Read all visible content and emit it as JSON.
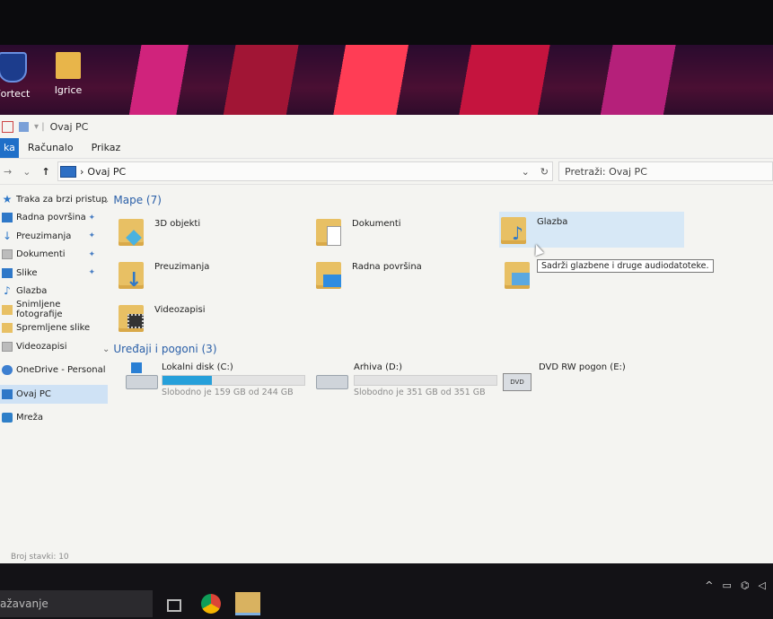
{
  "desktop": {
    "icons": [
      {
        "label": "Fortect",
        "icon": "shield-icon"
      },
      {
        "label": "Igrice",
        "icon": "folder-icon"
      }
    ]
  },
  "window": {
    "title": "Ovaj PC",
    "ribbon_tabs": [
      "ka",
      "Računalo",
      "Prikaz"
    ],
    "address": "Ovaj PC",
    "search_placeholder": "Pretraži: Ovaj PC",
    "status": "Broj stavki: 10"
  },
  "sidebar": {
    "items": [
      {
        "label": "Traka za brzi pristup",
        "icon": "star-icon",
        "pinned": false
      },
      {
        "label": "Radna površina",
        "icon": "desktop-icon",
        "pinned": true
      },
      {
        "label": "Preuzimanja",
        "icon": "download-icon",
        "pinned": true
      },
      {
        "label": "Dokumenti",
        "icon": "document-icon",
        "pinned": true
      },
      {
        "label": "Slike",
        "icon": "pictures-icon",
        "pinned": true
      },
      {
        "label": "Glazba",
        "icon": "music-icon",
        "pinned": false
      },
      {
        "label": "Snimljene fotografije",
        "icon": "folder-icon",
        "pinned": false
      },
      {
        "label": "Spremljene slike",
        "icon": "folder-icon",
        "pinned": false
      },
      {
        "label": "Videozapisi",
        "icon": "video-icon",
        "pinned": false
      },
      {
        "label": "OneDrive - Personal",
        "icon": "cloud-icon",
        "pinned": false
      },
      {
        "label": "Ovaj PC",
        "icon": "pc-icon",
        "pinned": false
      },
      {
        "label": "Mreža",
        "icon": "network-icon",
        "pinned": false
      }
    ]
  },
  "folders_group": {
    "title": "Mape (7)",
    "items": [
      {
        "label": "3D objekti"
      },
      {
        "label": "Dokumenti"
      },
      {
        "label": "Glazba"
      },
      {
        "label": "Preuzimanja"
      },
      {
        "label": "Radna površina"
      },
      {
        "label": ""
      },
      {
        "label": "Videozapisi"
      }
    ]
  },
  "drives_group": {
    "title": "Uređaji i pogoni (3)",
    "items": [
      {
        "label": "Lokalni disk (C:)",
        "free": "Slobodno je 159 GB od 244 GB",
        "used_fraction": 0.35
      },
      {
        "label": "Arhiva (D:)",
        "free": "Slobodno je 351 GB od 351 GB",
        "used_fraction": 0.0
      },
      {
        "label": "DVD RW pogon (E:)",
        "free": "",
        "used_fraction": null
      }
    ]
  },
  "tooltip": "Sadrži glazbene i druge audiodatoteke.",
  "taskbar": {
    "search_text": "ažavanje"
  }
}
